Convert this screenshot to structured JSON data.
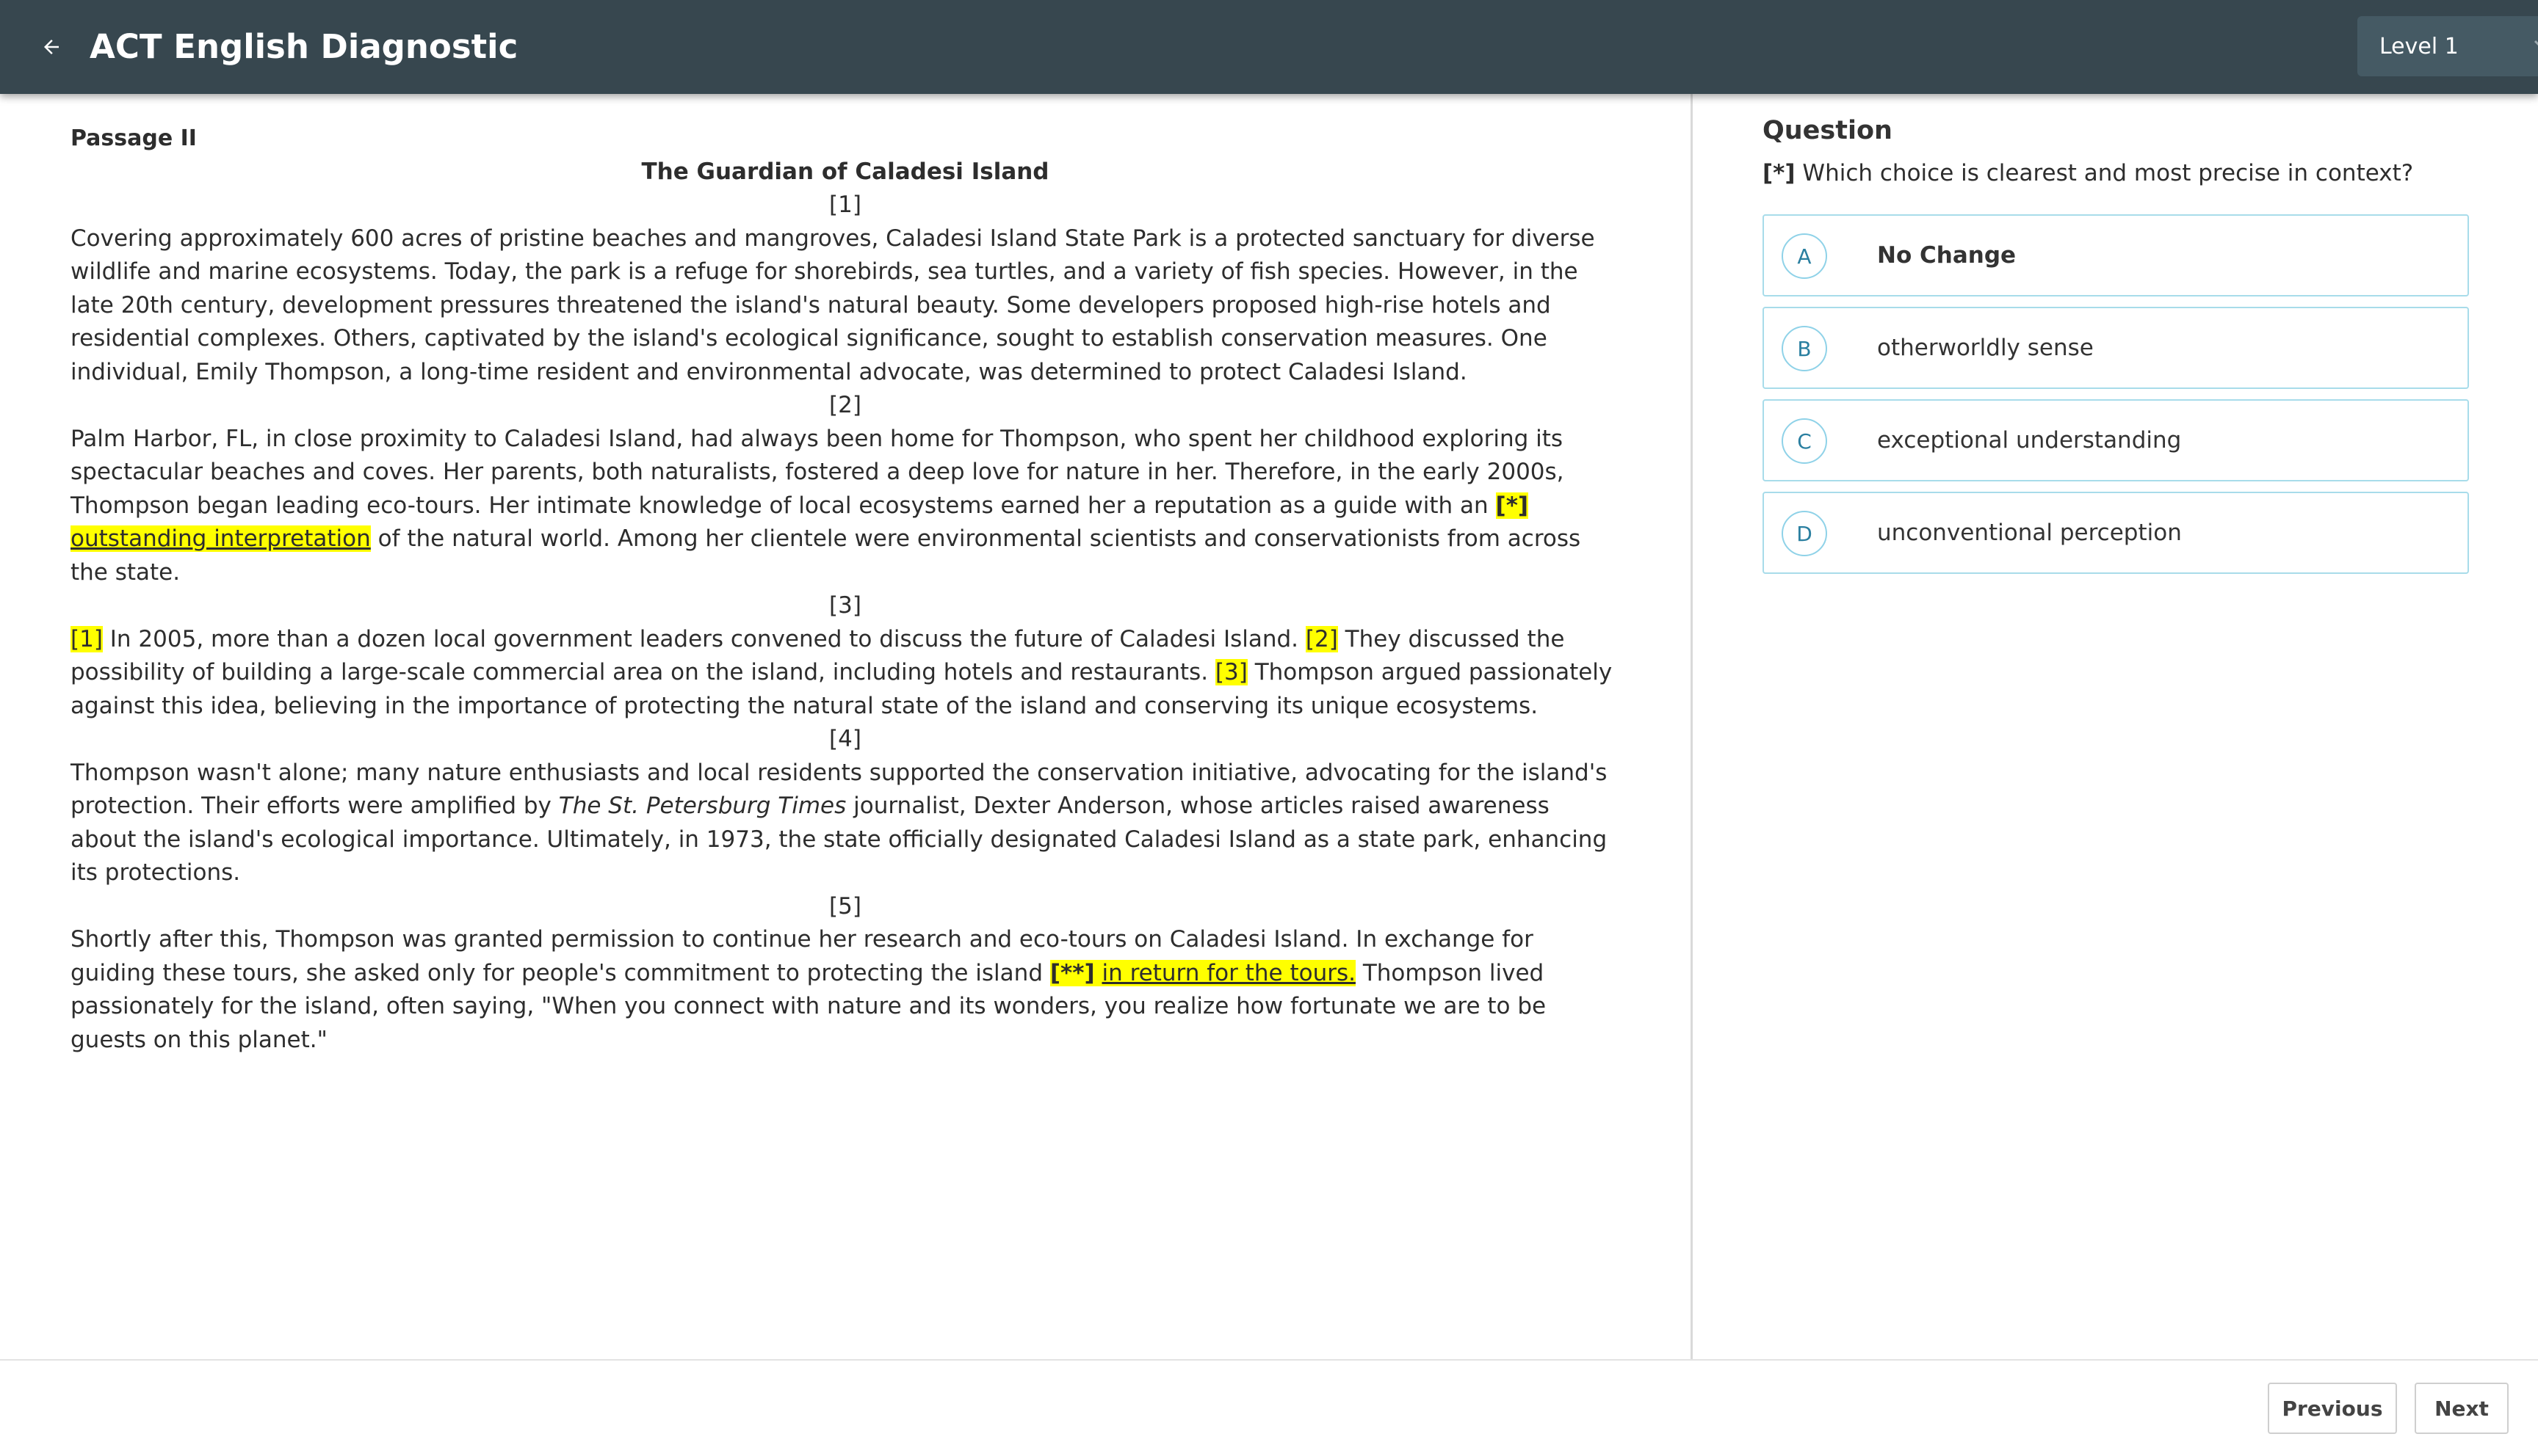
{
  "header": {
    "title": "ACT English Diagnostic",
    "level_value": "Level 1",
    "colors": {
      "bar": "#37474f",
      "select": "#455a64"
    }
  },
  "passage": {
    "label": "Passage II",
    "title": "The Guardian of Caladesi Island",
    "p1": {
      "num": "[1]",
      "text": "Covering approximately 600 acres of pristine beaches and mangroves, Caladesi Island State Park is a protected sanctuary for diverse wildlife and marine ecosystems. Today, the park is a refuge for shorebirds, sea turtles, and a variety of fish species. However, in the late 20th century, development pressures threatened the island's natural beauty. Some developers proposed high-rise hotels and residential complexes. Others, captivated by the island's ecological significance, sought to establish conservation measures. One individual, Emily Thompson, a long-time resident and environmental advocate, was determined to protect Caladesi Island."
    },
    "p2": {
      "num": "[2]",
      "before": "Palm Harbor, FL, in close proximity to Caladesi Island, had always been home for Thompson, who spent her childhood exploring its spectacular beaches and coves. Her parents, both naturalists, fostered a deep love for nature in her. Therefore, in the early 2000s, Thompson began leading eco-tours. Her intimate knowledge of local ecosystems earned her a reputation as a guide with an ",
      "marker": "[*]",
      "highlight": "outstanding interpretation",
      "after": " of the natural world. Among her clientele were environmental scientists and conservationists from across the state."
    },
    "p3": {
      "num": "[3]",
      "m1": "[1]",
      "s1": " In 2005, more than a dozen local government leaders convened to discuss the future of Caladesi Island. ",
      "m2": "[2]",
      "s2": " They discussed the possibility of building a large-scale commercial area on the island, including hotels and restaurants. ",
      "m3": "[3]",
      "s3": " Thompson argued passionately against this idea, believing in the importance of protecting the natural state of the island and conserving its unique ecosystems."
    },
    "p4": {
      "num": "[4]",
      "before": "Thompson wasn't alone; many nature enthusiasts and local residents supported the conservation initiative, advocating for the island's protection. Their efforts were amplified by ",
      "italic": "The St. Petersburg Times",
      "after": " journalist, Dexter Anderson, whose articles raised awareness about the island's ecological importance. Ultimately, in 1973, the state officially designated Caladesi Island as a state park, enhancing its protections."
    },
    "p5": {
      "num": "[5]",
      "before": "Shortly after this, Thompson was granted permission to continue her research and eco-tours on Caladesi Island. In exchange for guiding these tours, she asked only for people's commitment to protecting the island ",
      "marker": "[**]",
      "highlight": "in return for the tours.",
      "after": " Thompson lived passionately for the island, often saying, \"When you connect with nature and its wonders, you realize how fortunate we are to be guests on this planet.\""
    },
    "highlight_color": "#ffff00"
  },
  "question": {
    "heading": "Question",
    "tag": "[*]",
    "prompt": " Which choice is clearest and most precise in context?",
    "choices": [
      {
        "letter": "A",
        "text": "No Change"
      },
      {
        "letter": "B",
        "text": "otherworldly sense"
      },
      {
        "letter": "C",
        "text": "exceptional understanding"
      },
      {
        "letter": "D",
        "text": "unconventional perception"
      }
    ],
    "accent_color": "#a8dcea"
  },
  "footer": {
    "previous_label": "Previous",
    "next_label": "Next"
  }
}
